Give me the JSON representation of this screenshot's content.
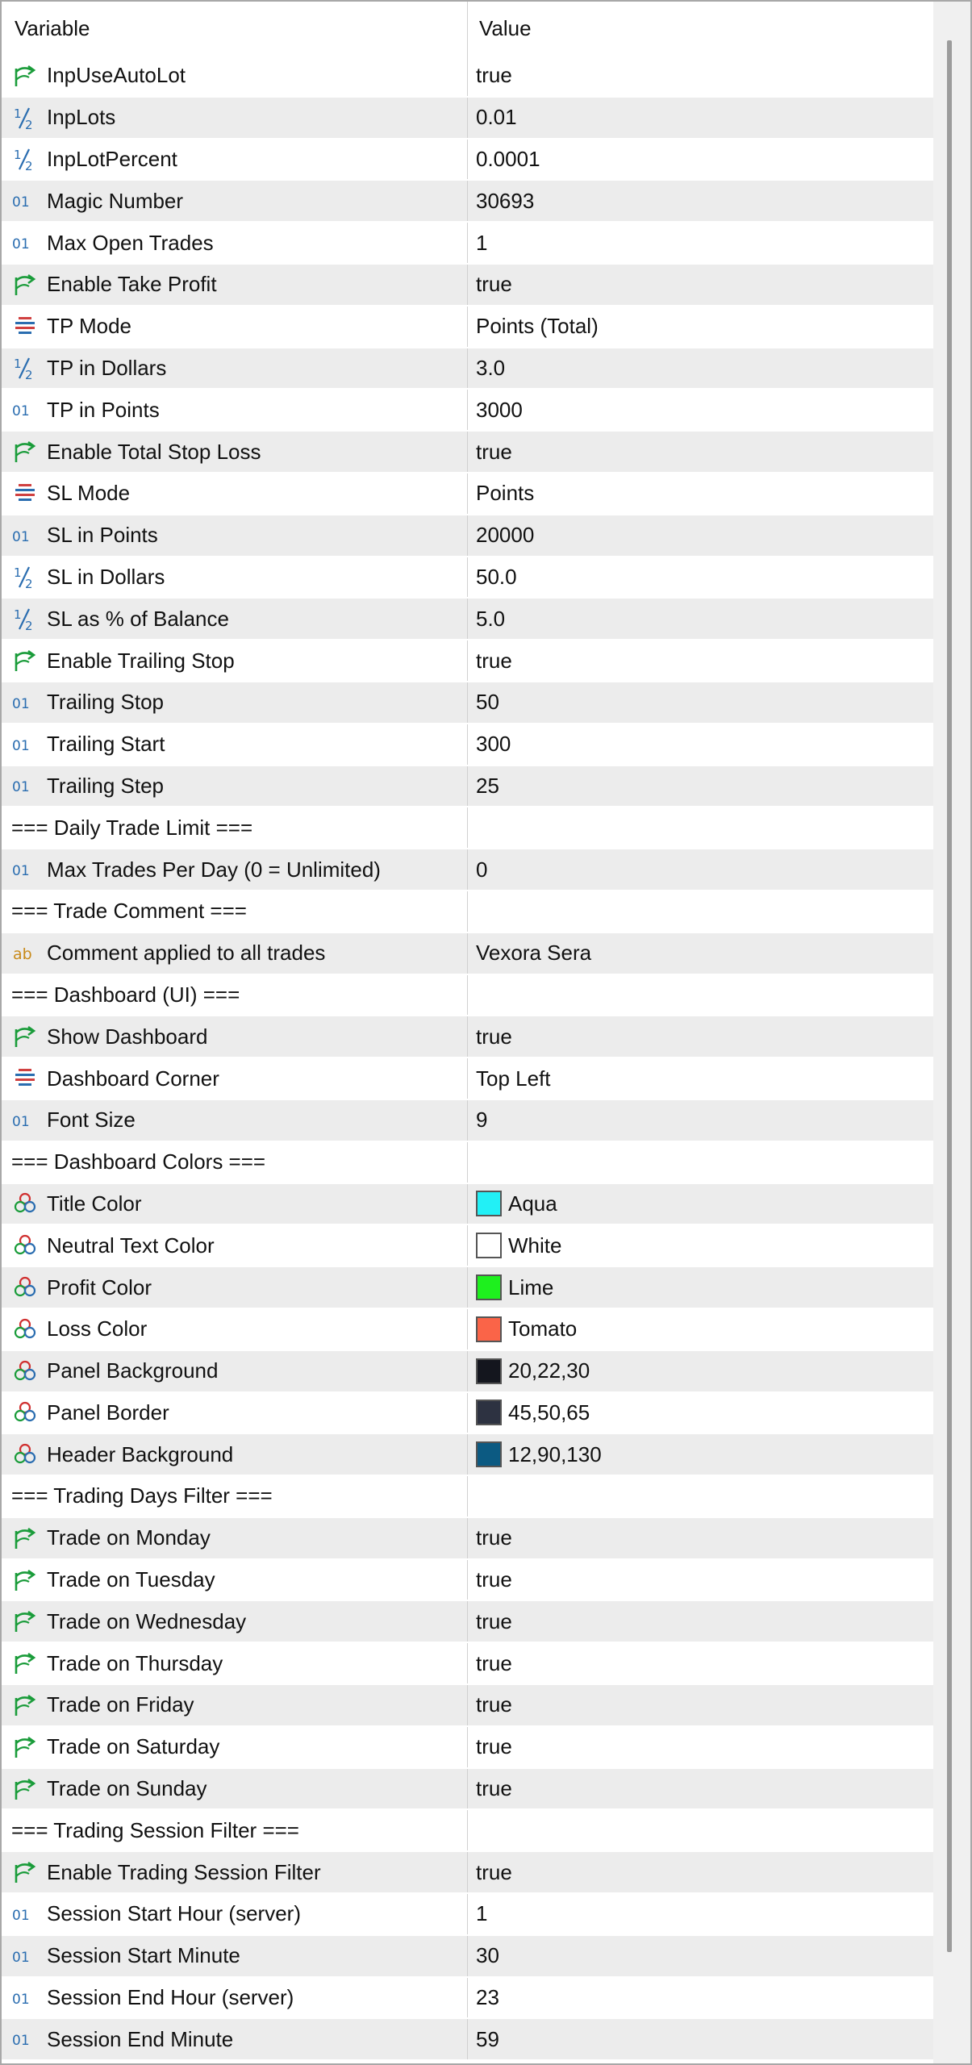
{
  "header": {
    "variable_label": "Variable",
    "value_label": "Value"
  },
  "colors": {
    "row_alt": "#ececec",
    "icon_bool": "#1a9c3a",
    "icon_int": "#2a6db0",
    "icon_enum": "#d04040",
    "icon_string": "#c88a1a"
  },
  "rows": [
    {
      "type": "bool",
      "icon": "bool-arrow-icon",
      "name": "InpUseAutoLot",
      "value": "true"
    },
    {
      "type": "double",
      "icon": "half-fraction-icon",
      "name": "InpLots",
      "value": "0.01"
    },
    {
      "type": "double",
      "icon": "half-fraction-icon",
      "name": "InpLotPercent",
      "value": "0.0001"
    },
    {
      "type": "int",
      "icon": "zero-one-icon",
      "name": "Magic Number",
      "value": "30693"
    },
    {
      "type": "int",
      "icon": "zero-one-icon",
      "name": "Max Open Trades",
      "value": "1"
    },
    {
      "type": "bool",
      "icon": "bool-arrow-icon",
      "name": "Enable Take Profit",
      "value": "true"
    },
    {
      "type": "enum",
      "icon": "enum-list-icon",
      "name": "TP Mode",
      "value": "Points (Total)"
    },
    {
      "type": "double",
      "icon": "half-fraction-icon",
      "name": "TP in Dollars",
      "value": "3.0"
    },
    {
      "type": "int",
      "icon": "zero-one-icon",
      "name": "TP in Points",
      "value": "3000"
    },
    {
      "type": "bool",
      "icon": "bool-arrow-icon",
      "name": "Enable Total Stop Loss",
      "value": "true"
    },
    {
      "type": "enum",
      "icon": "enum-list-icon",
      "name": "SL Mode",
      "value": "Points"
    },
    {
      "type": "int",
      "icon": "zero-one-icon",
      "name": "SL in Points",
      "value": "20000"
    },
    {
      "type": "double",
      "icon": "half-fraction-icon",
      "name": "SL in Dollars",
      "value": "50.0"
    },
    {
      "type": "double",
      "icon": "half-fraction-icon",
      "name": "SL as % of Balance",
      "value": "5.0"
    },
    {
      "type": "bool",
      "icon": "bool-arrow-icon",
      "name": "Enable Trailing Stop",
      "value": "true"
    },
    {
      "type": "int",
      "icon": "zero-one-icon",
      "name": "Trailing Stop",
      "value": "50"
    },
    {
      "type": "int",
      "icon": "zero-one-icon",
      "name": "Trailing Start",
      "value": "300"
    },
    {
      "type": "int",
      "icon": "zero-one-icon",
      "name": "Trailing Step",
      "value": "25"
    },
    {
      "type": "separator",
      "name": "=== Daily Trade Limit ===",
      "value": ""
    },
    {
      "type": "int",
      "icon": "zero-one-icon",
      "name": "Max Trades Per Day (0 = Unlimited)",
      "value": "0"
    },
    {
      "type": "separator",
      "name": "=== Trade Comment ===",
      "value": ""
    },
    {
      "type": "string",
      "icon": "ab-string-icon",
      "name": "Comment applied to all trades",
      "value": "Vexora Sera"
    },
    {
      "type": "separator",
      "name": "=== Dashboard (UI) ===",
      "value": ""
    },
    {
      "type": "bool",
      "icon": "bool-arrow-icon",
      "name": "Show Dashboard",
      "value": "true"
    },
    {
      "type": "enum",
      "icon": "enum-list-icon",
      "name": "Dashboard Corner",
      "value": "Top Left"
    },
    {
      "type": "int",
      "icon": "zero-one-icon",
      "name": "Font Size",
      "value": "9"
    },
    {
      "type": "separator",
      "name": "=== Dashboard Colors ===",
      "value": ""
    },
    {
      "type": "color",
      "icon": "color-circles-icon",
      "name": "Title Color",
      "value": "Aqua",
      "swatch": "#22f0f6"
    },
    {
      "type": "color",
      "icon": "color-circles-icon",
      "name": "Neutral Text Color",
      "value": "White",
      "swatch": "#ffffff"
    },
    {
      "type": "color",
      "icon": "color-circles-icon",
      "name": "Profit Color",
      "value": "Lime",
      "swatch": "#1ef01e"
    },
    {
      "type": "color",
      "icon": "color-circles-icon",
      "name": "Loss Color",
      "value": "Tomato",
      "swatch": "#fa6448"
    },
    {
      "type": "color",
      "icon": "color-circles-icon",
      "name": "Panel Background",
      "value": "20,22,30",
      "swatch": "#14161e"
    },
    {
      "type": "color",
      "icon": "color-circles-icon",
      "name": "Panel Border",
      "value": "45,50,65",
      "swatch": "#2d3241"
    },
    {
      "type": "color",
      "icon": "color-circles-icon",
      "name": "Header Background",
      "value": "12,90,130",
      "swatch": "#0c5a82"
    },
    {
      "type": "separator",
      "name": "=== Trading Days Filter ===",
      "value": ""
    },
    {
      "type": "bool",
      "icon": "bool-arrow-icon",
      "name": "Trade on Monday",
      "value": "true"
    },
    {
      "type": "bool",
      "icon": "bool-arrow-icon",
      "name": "Trade on Tuesday",
      "value": "true"
    },
    {
      "type": "bool",
      "icon": "bool-arrow-icon",
      "name": "Trade on Wednesday",
      "value": "true"
    },
    {
      "type": "bool",
      "icon": "bool-arrow-icon",
      "name": "Trade on Thursday",
      "value": "true"
    },
    {
      "type": "bool",
      "icon": "bool-arrow-icon",
      "name": "Trade on Friday",
      "value": "true"
    },
    {
      "type": "bool",
      "icon": "bool-arrow-icon",
      "name": "Trade on Saturday",
      "value": "true"
    },
    {
      "type": "bool",
      "icon": "bool-arrow-icon",
      "name": "Trade on Sunday",
      "value": "true"
    },
    {
      "type": "separator",
      "name": "=== Trading Session Filter ===",
      "value": ""
    },
    {
      "type": "bool",
      "icon": "bool-arrow-icon",
      "name": "Enable Trading Session Filter",
      "value": "true"
    },
    {
      "type": "int",
      "icon": "zero-one-icon",
      "name": "Session Start Hour (server)",
      "value": "1"
    },
    {
      "type": "int",
      "icon": "zero-one-icon",
      "name": "Session Start Minute",
      "value": "30"
    },
    {
      "type": "int",
      "icon": "zero-one-icon",
      "name": "Session End Hour (server)",
      "value": "23"
    },
    {
      "type": "int",
      "icon": "zero-one-icon",
      "name": "Session End Minute",
      "value": "59"
    }
  ]
}
